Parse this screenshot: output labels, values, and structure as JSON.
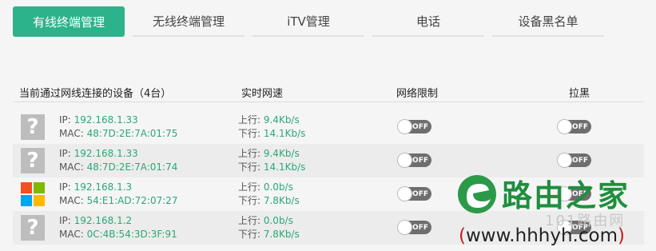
{
  "tabs": [
    {
      "label": "有线终端管理",
      "active": true
    },
    {
      "label": "无线终端管理",
      "active": false
    },
    {
      "label": "iTV管理",
      "active": false
    },
    {
      "label": "电话",
      "active": false
    },
    {
      "label": "设备黑名单",
      "active": false
    }
  ],
  "table": {
    "headers": {
      "devices": "当前通过网线连接的设备（4台）",
      "speed": "实时网速",
      "limit": "网络限制",
      "blacklist": "拉黑"
    },
    "rows": [
      {
        "icon": "unknown-device-icon",
        "ip_label": "IP: ",
        "ip": "192.168.1.33",
        "mac_label": "MAC: ",
        "mac": "48:7D:2E:7A:01:75",
        "up_label": "上行: ",
        "up": "9.4Kb/s",
        "down_label": "下行: ",
        "down": "14.1Kb/s",
        "limit_state": "OFF",
        "black_state": "OFF"
      },
      {
        "icon": "unknown-device-icon",
        "ip_label": "IP: ",
        "ip": "192.168.1.33",
        "mac_label": "MAC: ",
        "mac": "48:7D:2E:7A:01:74",
        "up_label": "上行: ",
        "up": "9.4Kb/s",
        "down_label": "下行: ",
        "down": "14.1Kb/s",
        "limit_state": "OFF",
        "black_state": "OFF"
      },
      {
        "icon": "windows-logo-icon",
        "ip_label": "IP: ",
        "ip": "192.168.1.3",
        "mac_label": "MAC: ",
        "mac": "54:E1:AD:72:07:27",
        "up_label": "上行: ",
        "up": "0.0b/s",
        "down_label": "下行: ",
        "down": "7.8Kb/s",
        "limit_state": "OFF",
        "black_state": "OFF"
      },
      {
        "icon": "unknown-device-icon",
        "ip_label": "IP: ",
        "ip": "192.168.1.2",
        "mac_label": "MAC: ",
        "mac": "0C:4B:54:3D:3F:91",
        "up_label": "上行: ",
        "up": "0.0b/s",
        "down_label": "下行: ",
        "down": "7.8Kb/s",
        "limit_state": "OFF",
        "black_state": "OFF"
      }
    ]
  },
  "watermark": {
    "title": "路由之家",
    "subtitle": "101路由网",
    "url_open": "(",
    "url": "www.hhhyh.com",
    "url_close": ")"
  },
  "colors": {
    "accent": "#2cb38c",
    "value_green": "#2aa876",
    "toggle_off": "#6e6e6e",
    "watermark_green": "#1e8f3e"
  }
}
